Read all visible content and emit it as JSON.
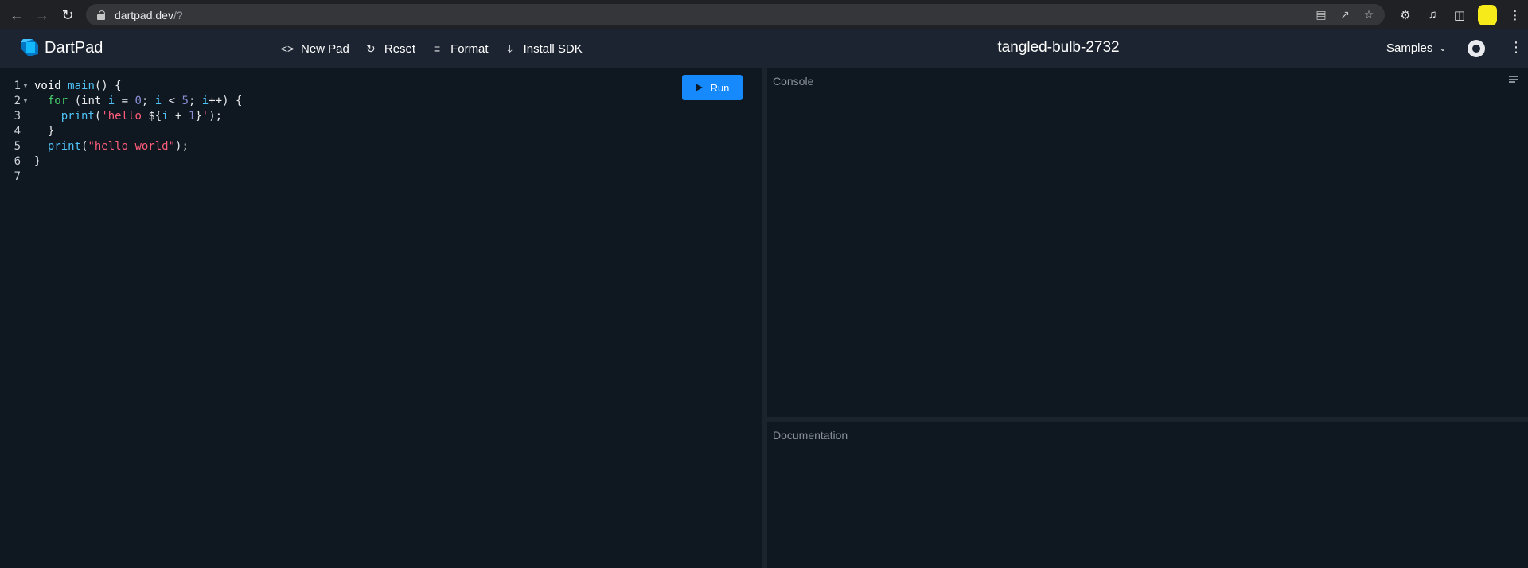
{
  "browser": {
    "url_host": "dartpad.dev",
    "url_path": "/?"
  },
  "app": {
    "brand": "DartPad",
    "pad_title": "tangled-bulb-2732",
    "toolbar": {
      "new_pad": "New Pad",
      "reset": "Reset",
      "format": "Format",
      "install_sdk": "Install SDK"
    },
    "samples_label": "Samples"
  },
  "editor": {
    "run_label": "Run",
    "lines": [
      {
        "num": "1",
        "fold": "▼"
      },
      {
        "num": "2",
        "fold": "▼"
      },
      {
        "num": "3",
        "fold": ""
      },
      {
        "num": "4",
        "fold": ""
      },
      {
        "num": "5",
        "fold": ""
      },
      {
        "num": "6",
        "fold": ""
      },
      {
        "num": "7",
        "fold": ""
      }
    ],
    "code": {
      "l1": {
        "kw": "void",
        "fn": "main",
        "rest": "() {"
      },
      "l2": {
        "for": "for",
        "p1": " (int ",
        "i1": "i",
        "p2": " = ",
        "zero": "0",
        "p3": "; ",
        "i2": "i",
        "p4": " < ",
        "five": "5",
        "p5": "; ",
        "i3": "i",
        "p6": "++) {"
      },
      "l3": {
        "fn": "print",
        "p1": "(",
        "s1": "'hello ",
        "p2": "${",
        "i": "i",
        "p3": " + ",
        "one": "1",
        "p4": "}",
        "s2": "'",
        "p5": ");"
      },
      "l4": {
        "text": "}"
      },
      "l5": {
        "fn": "print",
        "p1": "(",
        "s": "\"hello world\"",
        "p2": ");"
      },
      "l6": {
        "text": "}"
      },
      "l7": {
        "text": ""
      }
    }
  },
  "panels": {
    "console_label": "Console",
    "docs_label": "Documentation"
  },
  "colors": {
    "accent": "#168afd",
    "background": "#0f1720",
    "header": "#1b2430"
  }
}
